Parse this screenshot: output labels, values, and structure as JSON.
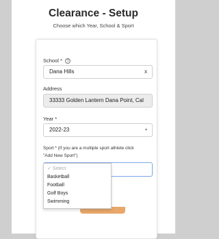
{
  "header": {
    "title": "Clearance - Setup",
    "subtitle": "Choose which Year, School & Sport"
  },
  "form": {
    "school": {
      "label": "School *",
      "value": "Dana Hills",
      "clear": "x",
      "help": "?"
    },
    "address": {
      "label": "Address",
      "value": "33333 Golden Lantern Dana Point, Cal"
    },
    "year": {
      "label": "Year *",
      "value": "2022-23",
      "chevron": "▾"
    },
    "sport": {
      "label_line1": "Sport * (If you are a multiple sport athlete click",
      "label_line2": "\"Add New Sport\")",
      "options": [
        "✓ Select",
        "Basketball",
        "Football",
        "Golf Boys",
        "Swimming"
      ]
    }
  },
  "colors": {
    "accent": "#7aa7e6",
    "button": "#e8a86a"
  }
}
